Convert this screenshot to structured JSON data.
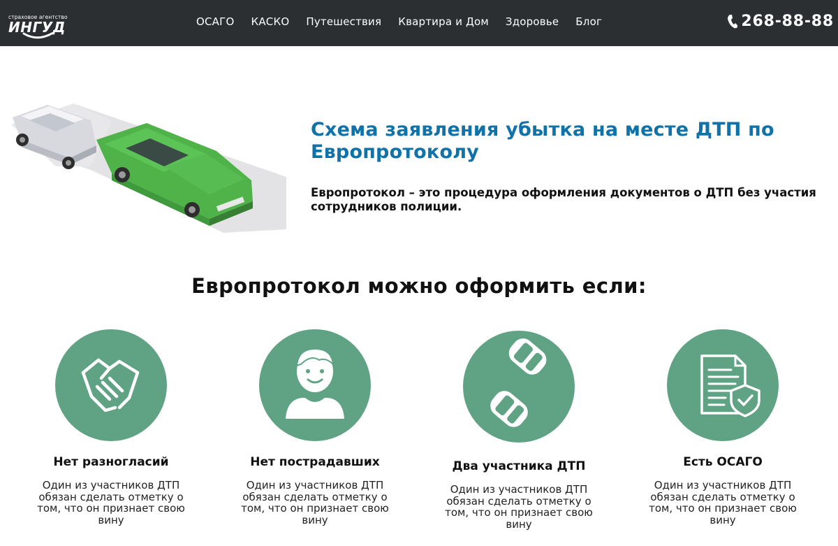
{
  "header": {
    "logo_tagline": "страховое агентство",
    "logo_word": "ИНГУД",
    "nav": [
      "ОСАГО",
      "КАСКО",
      "Путешествия",
      "Квартира и Дом",
      "Здоровье",
      "Блог"
    ],
    "phone": "268-88-88"
  },
  "hero": {
    "title": "Схема заявления убытка на месте ДТП по Европротоколу",
    "subtitle": "Европротокол – это процедура оформления документов о ДТП без участия сотрудников полиции."
  },
  "conditions": {
    "title": "Европротокол можно оформить если:",
    "items": [
      {
        "icon": "handshake-icon",
        "title": "Нет разногласий",
        "text": "Один из участников ДТП обязан сделать отметку о том, что он признает свою вину"
      },
      {
        "icon": "person-icon",
        "title": "Нет пострадавших",
        "text": "Один из участников ДТП обязан сделать отметку о том, что он признает свою вину"
      },
      {
        "icon": "two-cars-icon",
        "title": "Два участника ДТП",
        "text": "Один из участников ДТП обязан сделать отметку о том, что он признает свою вину"
      },
      {
        "icon": "insurance-document-icon",
        "title": "Есть ОСАГО",
        "text": "Один из участников ДТП обязан сделать отметку о том, что он признает свою вину"
      }
    ]
  },
  "colors": {
    "header_bg": "#2b2f31",
    "title_blue": "#0f72a8",
    "circle_green": "#5fa384",
    "car_green": "#4fb34a"
  }
}
